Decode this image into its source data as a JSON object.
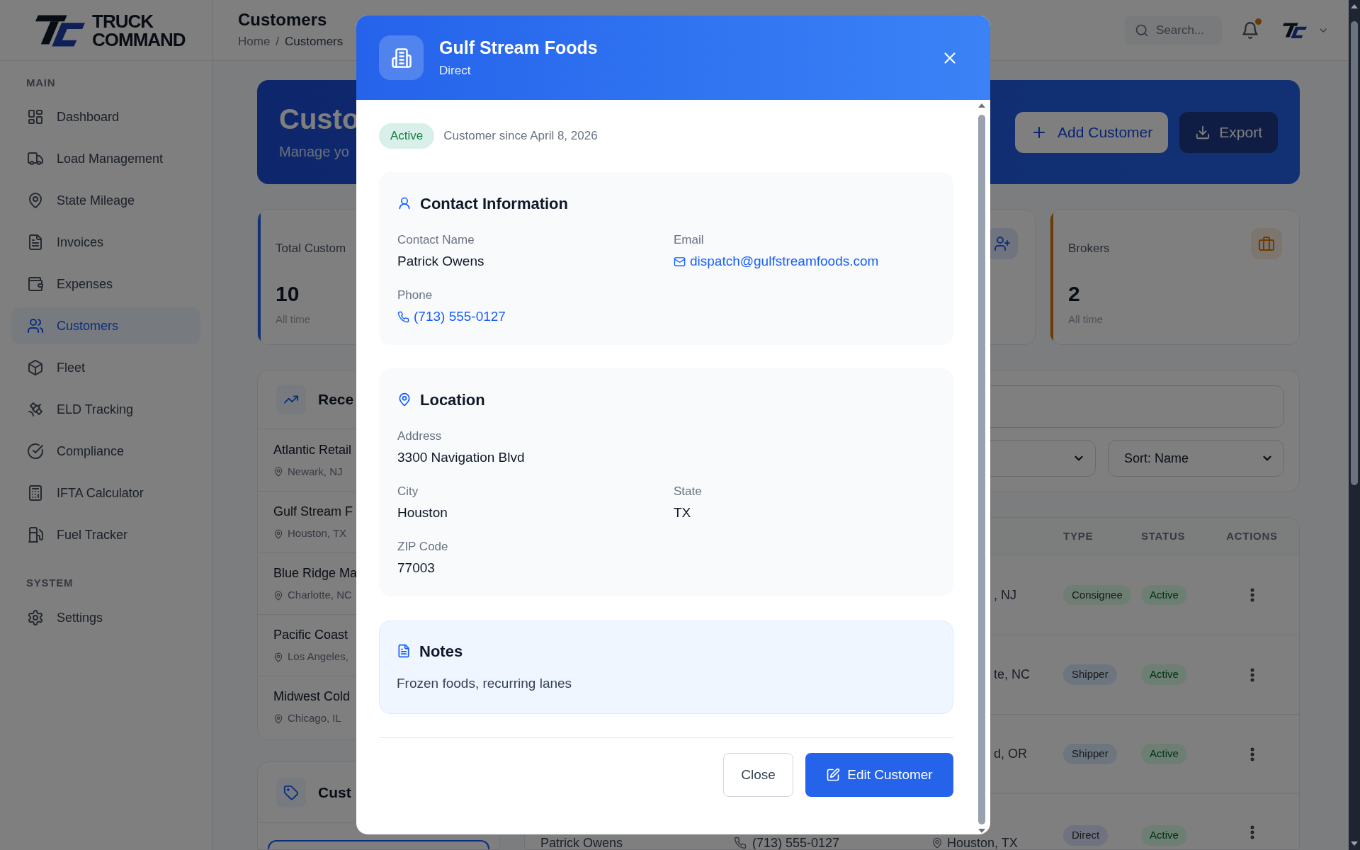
{
  "brand": {
    "line1": "TRUCK",
    "line2": "COMMAND"
  },
  "sidebar": {
    "sections": [
      {
        "heading": "MAIN",
        "items": [
          {
            "label": "Dashboard",
            "selected": false
          },
          {
            "label": "Load Management",
            "selected": false
          },
          {
            "label": "State Mileage",
            "selected": false
          },
          {
            "label": "Invoices",
            "selected": false
          },
          {
            "label": "Expenses",
            "selected": false
          },
          {
            "label": "Customers",
            "selected": true
          },
          {
            "label": "Fleet",
            "selected": false
          },
          {
            "label": "ELD Tracking",
            "selected": false
          },
          {
            "label": "Compliance",
            "selected": false
          },
          {
            "label": "IFTA Calculator",
            "selected": false
          },
          {
            "label": "Fuel Tracker",
            "selected": false
          }
        ]
      },
      {
        "heading": "SYSTEM",
        "items": [
          {
            "label": "Settings",
            "selected": false
          }
        ]
      }
    ]
  },
  "header": {
    "title": "Customers",
    "breadcrumb": [
      "Home",
      "Customers"
    ],
    "separator": "/",
    "search_placeholder": "Search...",
    "notification": true
  },
  "banner": {
    "title": "Custo",
    "subtitle": "Manage yo",
    "buttons": [
      {
        "label": "Add Customer",
        "kind": "add"
      },
      {
        "label": "Export",
        "kind": "export"
      }
    ]
  },
  "stats": [
    {
      "label": "Total Custom",
      "value": "10",
      "note": "All time",
      "color": "#123175"
    },
    {
      "color": "#123175"
    },
    {
      "label": "Brokers",
      "value": "2",
      "note": "All time",
      "color": "#6c3b03"
    }
  ],
  "recent": {
    "title": "Rece",
    "items": [
      {
        "name": "Atlantic Retail",
        "location": "Newark, NJ"
      },
      {
        "name": "Gulf Stream F",
        "location": "Houston, TX"
      },
      {
        "name": "Blue Ridge Ma",
        "location": "Charlotte, NC"
      },
      {
        "name": "Pacific Coast",
        "location": "Los Angeles,"
      },
      {
        "name": "Midwest Cold",
        "location": "Chicago, IL"
      }
    ]
  },
  "second_card": {
    "title": "Cust"
  },
  "filters": {
    "sort": "Sort: Name"
  },
  "table": {
    "columns": [
      "TYPE",
      "STATUS",
      "ACTIONS"
    ],
    "rows": [
      {
        "kind": "partial",
        "location": ", NJ",
        "type": "Consignee",
        "color": "#6e7e73",
        "status": "Active"
      },
      {
        "kind": "partial",
        "location": "te, NC",
        "type": "Shipper",
        "color": "#6d757f",
        "status": "Active"
      },
      {
        "kind": "partial",
        "location": "d, OR",
        "type": "Shipper",
        "color": "#6d757f",
        "status": "Active"
      },
      {
        "kind": "full",
        "contact": "Patrick Owens",
        "phone": "(713) 555-0127",
        "location": "Houston, TX",
        "type": "Direct",
        "color": "#70737f",
        "status": "Active"
      }
    ]
  },
  "modal": {
    "title": "Gulf Stream Foods",
    "subtitle": "Direct",
    "status": "Active",
    "since": "Customer since April 8, 2026",
    "sections": [
      {
        "kind": "contact",
        "title": "Contact Information",
        "fields": [
          {
            "kind": "text",
            "label": "Contact Name",
            "value": "Patrick Owens"
          },
          {
            "kind": "email",
            "label": "Email",
            "value": "dispatch@gulfstreamfoods.com"
          },
          {
            "kind": "phone",
            "label": "Phone",
            "value": "(713) 555-0127"
          }
        ]
      },
      {
        "kind": "location",
        "title": "Location",
        "fields": [
          {
            "kind": "address",
            "label": "Address",
            "value": "3300 Navigation Blvd"
          },
          {
            "kind": "text",
            "label": "City",
            "value": "Houston"
          },
          {
            "kind": "text",
            "label": "State",
            "value": "TX"
          },
          {
            "kind": "text",
            "label": "ZIP Code",
            "value": "77003"
          }
        ]
      },
      {
        "kind": "notes",
        "title": "Notes",
        "text": "Frozen foods, recurring lanes"
      }
    ],
    "buttons": [
      {
        "label": "Close",
        "kind": "secondary"
      },
      {
        "label": "Edit Customer",
        "kind": "primary"
      }
    ]
  }
}
